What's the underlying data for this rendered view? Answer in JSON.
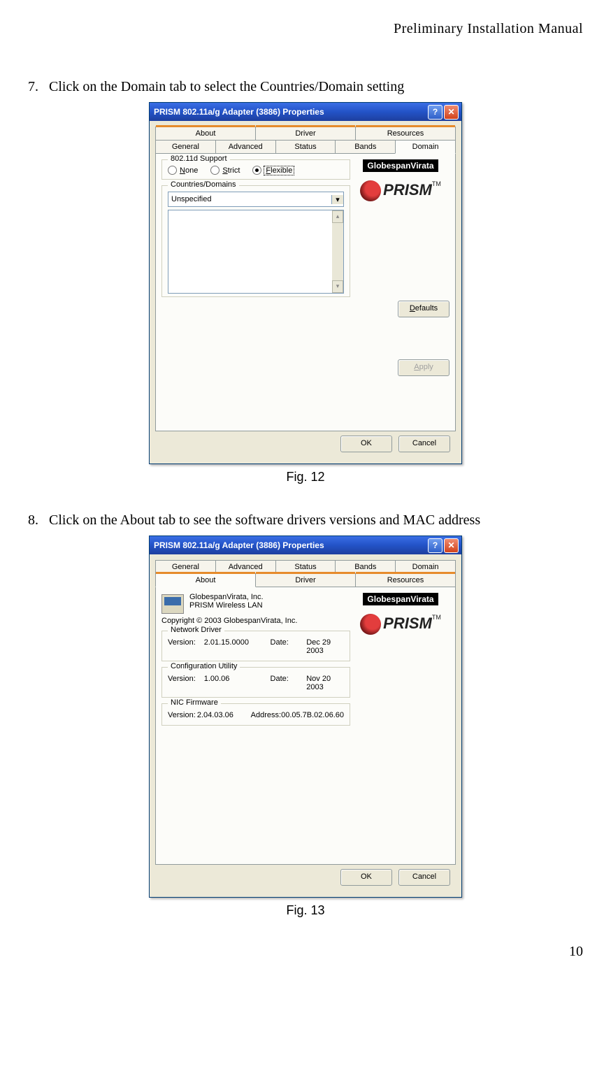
{
  "header": "Preliminary  Installation  Manual",
  "page_number": "10",
  "steps": {
    "s7": {
      "num": "7.",
      "text": "Click on the Domain tab to select the Countries/Domain setting"
    },
    "s8": {
      "num": "8.",
      "text": "Click on the About tab to see the software drivers versions and MAC address"
    }
  },
  "captions": {
    "fig12": "Fig. 12",
    "fig13": "Fig. 13"
  },
  "common": {
    "title": "PRISM 802.11a/g Adapter (3886) Properties",
    "ok": "OK",
    "cancel": "Cancel",
    "help": "?",
    "close": "✕",
    "brand_badge": "GlobespanVirata",
    "brand_logo": "PRISM",
    "tm": "TM"
  },
  "tabs": {
    "general": "General",
    "advanced": "Advanced",
    "status": "Status",
    "bands": "Bands",
    "domain": "Domain",
    "about": "About",
    "driver": "Driver",
    "resources": "Resources"
  },
  "dlg12": {
    "group_support": "802.11d Support",
    "opt_none": "None",
    "opt_strict": "Strict",
    "opt_flexible": "Flexible",
    "group_domains": "Countries/Domains",
    "combo_value": "Unspecified",
    "defaults": "Defaults",
    "apply": "Apply"
  },
  "dlg13": {
    "vendor": "GlobespanVirata, Inc.",
    "product": "PRISM Wireless LAN",
    "copyright": "Copyright © 2003  GlobespanVirata, Inc.",
    "net": {
      "legend": "Network Driver",
      "ver_lab": "Version:",
      "ver": "2.01.15.0000",
      "date_lab": "Date:",
      "date": "Dec 29 2003"
    },
    "cfg": {
      "legend": "Configuration Utility",
      "ver_lab": "Version:",
      "ver": "1.00.06",
      "date_lab": "Date:",
      "date": "Nov 20 2003"
    },
    "nic": {
      "legend": "NIC Firmware",
      "ver_lab": "Version:",
      "ver": "2.04.03.06",
      "addr_lab": "Address:",
      "addr": "00.05.7B.02.06.60"
    }
  }
}
